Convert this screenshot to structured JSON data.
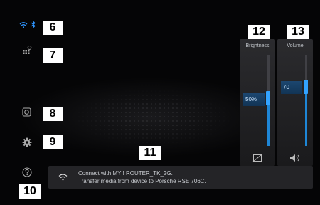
{
  "badges": {
    "status": "6",
    "apps": "7",
    "media": "8",
    "settings": "9",
    "help": "10",
    "notification": "11",
    "brightness": "12",
    "volume": "13"
  },
  "brightness": {
    "title": "Brightness",
    "value_label": "50%",
    "level": 0.5
  },
  "volume": {
    "title": "Volume",
    "value_label": "70",
    "level": 0.7
  },
  "notification": {
    "line1": "Connect with MY ! ROUTER_TK_2G.",
    "line2": "Transfer media from device to Porsche RSE 706C."
  },
  "colors": {
    "accent": "#1e86d6",
    "status_icons": "#2f95ff"
  },
  "icons": [
    "wifi-icon",
    "bluetooth-icon",
    "apps-grid-icon",
    "media-source-icon",
    "gear-icon",
    "help-icon",
    "screen-off-icon",
    "speaker-icon"
  ]
}
